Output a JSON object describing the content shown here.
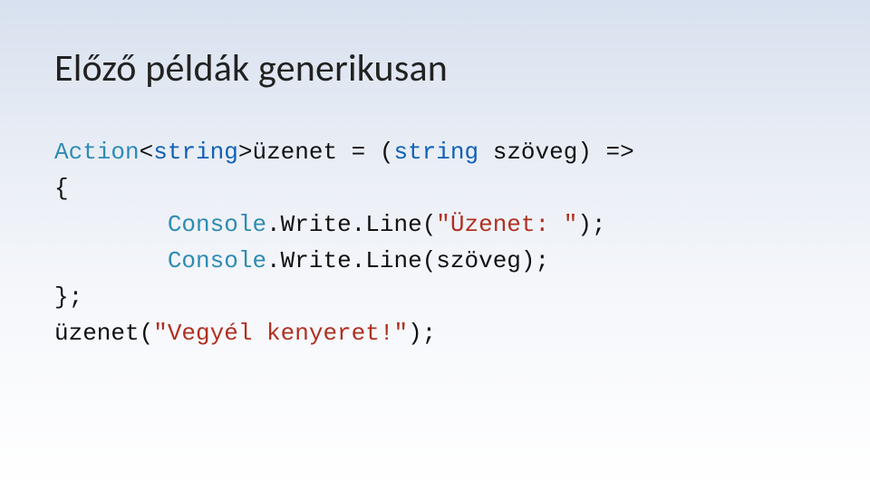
{
  "title": "Előző példák generikusan",
  "code": {
    "t_action": "Action",
    "t_lt": "<",
    "t_string1": "string",
    "t_gt": ">",
    "t_var": "üzenet = (",
    "t_string2": "string",
    "t_param": " szöveg) =>",
    "t_open": "{",
    "t_indent": "        ",
    "t_cw1a": "Console",
    "t_cw1b": ".",
    "t_cw1c": "Write",
    "t_cw1d": ".",
    "t_cw1e": "Line(",
    "t_str1": "\"Üzenet: \"",
    "t_cw1f": ");",
    "t_cw2a": "Console",
    "t_cw2b": ".",
    "t_cw2c": "Write",
    "t_cw2d": ".",
    "t_cw2e": "Line(szöveg);",
    "t_close": "};",
    "t_call1": "üzenet(",
    "t_str2": "\"Vegyél kenyeret!\"",
    "t_call2": ");"
  }
}
